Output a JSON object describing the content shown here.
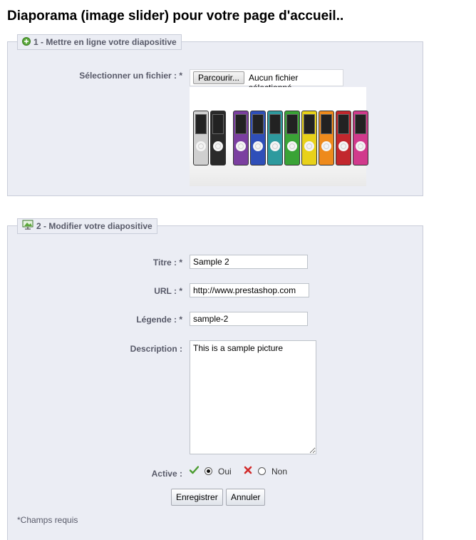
{
  "page": {
    "title": "Diaporama (image slider) pour votre page d'accueil.."
  },
  "section1": {
    "legend": "1 - Mettre en ligne votre diapositive",
    "file_label": "Sélectionner un fichier : *",
    "file_button": "Parcourir...",
    "file_status": "Aucun fichier sélectionné.",
    "preview_colors": [
      "#cfcfcf",
      "#2a2a2a",
      "#7b3fa0",
      "#2f4fb8",
      "#2e9a9e",
      "#3aa336",
      "#e8d11a",
      "#ee8a1c",
      "#c2272d",
      "#d13a8c"
    ]
  },
  "section2": {
    "legend": "2 - Modifier votre diapositive",
    "title_label": "Titre : *",
    "title_value": "Sample 2",
    "url_label": "URL : *",
    "url_value": "http://www.prestashop.com",
    "caption_label": "Légende : *",
    "caption_value": "sample-2",
    "description_label": "Description :",
    "description_value": "This is a sample picture",
    "active_label": "Active :",
    "yes_label": "Oui",
    "no_label": "Non",
    "active_selected": "Oui",
    "save_button": "Enregistrer",
    "cancel_button": "Annuler",
    "required_note": "*Champs requis"
  },
  "icons": {
    "upload": "add-circle-icon",
    "edit": "slideshow-icon",
    "yes": "check-icon",
    "no": "cross-icon"
  },
  "colors": {
    "fieldset_bg": "#ebedf4",
    "label": "#585a69",
    "check": "#4a9c2f",
    "cross": "#d22b2b"
  }
}
